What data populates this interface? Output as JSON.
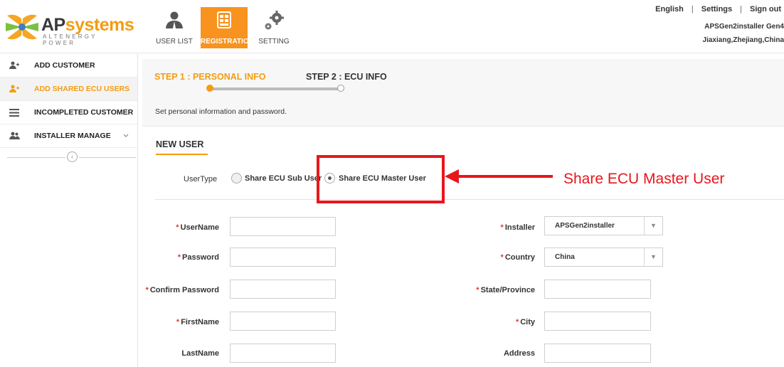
{
  "brand": {
    "name_part1": "AP",
    "name_part2": "systems",
    "tagline": "ALTENERGY POWER"
  },
  "topnav": [
    {
      "label": "USER LIST",
      "icon": "user-icon"
    },
    {
      "label": "REGISTRATION",
      "icon": "registration-icon",
      "active": true
    },
    {
      "label": "SETTING",
      "icon": "gears-icon"
    }
  ],
  "toplinks": {
    "language": "English",
    "settings": "Settings",
    "signout": "Sign out"
  },
  "user": {
    "line1": "APSGen2installer Gen4",
    "line2": "Jiaxiang,Zhejiang,China"
  },
  "sidebar": {
    "items": [
      {
        "label": "ADD CUSTOMER",
        "icon": "add-user-icon"
      },
      {
        "label": "ADD SHARED ECU USERS",
        "icon": "add-user-icon",
        "active": true
      },
      {
        "label": "INCOMPLETED CUSTOMER",
        "icon": "list-icon"
      },
      {
        "label": "INSTALLER MANAGE",
        "icon": "users-icon",
        "expandable": true
      }
    ],
    "collapse_glyph": "‹"
  },
  "steps": {
    "step1": "STEP 1 : PERSONAL INFO",
    "step2": "STEP 2 : ECU INFO",
    "description": "Set personal information and password."
  },
  "form": {
    "section_title": "NEW USER",
    "usertype_label": "UserType",
    "usertype_options": [
      {
        "label": "Share ECU Sub User",
        "checked": false
      },
      {
        "label": "Share ECU Master User",
        "checked": true
      }
    ],
    "left_fields": [
      {
        "label": "UserName",
        "required": true,
        "value": ""
      },
      {
        "label": "Password",
        "required": true,
        "value": ""
      },
      {
        "label": "Confirm Password",
        "required": true,
        "value": ""
      },
      {
        "label": "FirstName",
        "required": true,
        "value": ""
      },
      {
        "label": "LastName",
        "required": false,
        "value": ""
      }
    ],
    "right_fields": [
      {
        "label": "Installer",
        "required": true,
        "type": "select",
        "value": "APSGen2installer"
      },
      {
        "label": "Country",
        "required": true,
        "type": "select",
        "value": "China"
      },
      {
        "label": "State/Province",
        "required": true,
        "type": "input",
        "value": ""
      },
      {
        "label": "City",
        "required": true,
        "type": "input",
        "value": ""
      },
      {
        "label": "Address",
        "required": false,
        "type": "input",
        "value": ""
      }
    ],
    "required_mark": "*",
    "caret": "▼"
  },
  "annotation": {
    "text": "Share ECU Master User",
    "color": "#e8161b"
  },
  "colors": {
    "accent": "#f39c12",
    "nav_active": "#f7931e"
  }
}
